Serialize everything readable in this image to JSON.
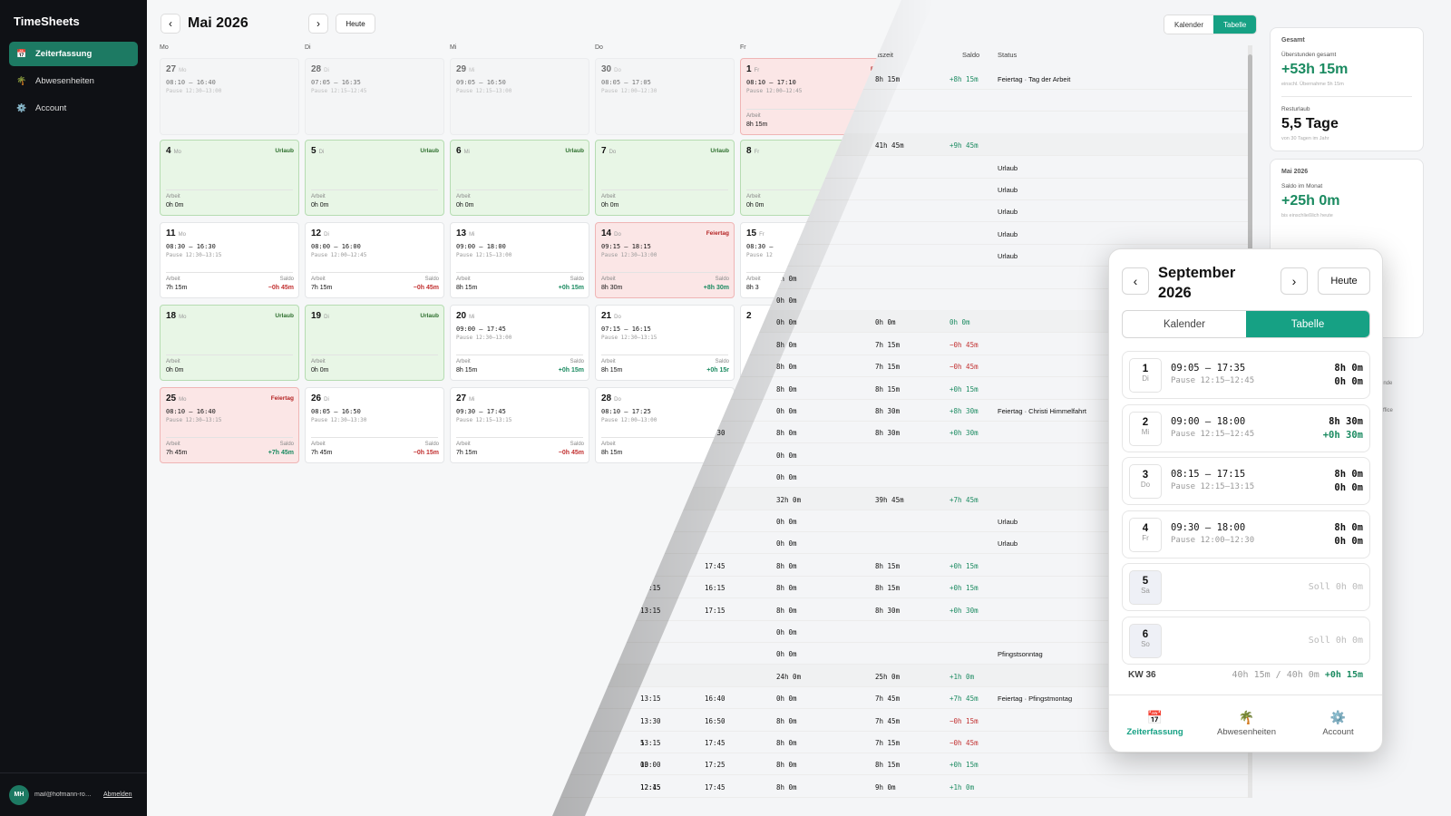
{
  "sidebar": {
    "brand": "TimeSheets",
    "items": [
      {
        "label": "Zeiterfassung",
        "icon": "📅"
      },
      {
        "label": "Abwesenheiten",
        "icon": "🌴"
      },
      {
        "label": "Account",
        "icon": "⚙️"
      }
    ],
    "avatar": "MH",
    "email": "mail@hofmann-ro…",
    "logout": "Abmelden"
  },
  "calendar": {
    "month": "Mai 2026",
    "today": "Heute",
    "prev": "‹",
    "next": "›",
    "dows": [
      "Mo",
      "Di",
      "Mi",
      "Do",
      "Fr"
    ],
    "weeks": [
      [
        {
          "d": "27",
          "w": "Mo",
          "type": "dim",
          "t": "08:10 – 16:40",
          "p": "Pause 12:30–13:00"
        },
        {
          "d": "28",
          "w": "Di",
          "type": "dim",
          "t": "07:05 – 16:35",
          "p": "Pause 12:15–12:45"
        },
        {
          "d": "29",
          "w": "Mi",
          "type": "dim",
          "t": "09:05 – 16:50",
          "p": "Pause 12:15–13:00"
        },
        {
          "d": "30",
          "w": "Do",
          "type": "dim",
          "t": "08:05 – 17:05",
          "p": "Pause 12:00–12:30"
        },
        {
          "d": "1",
          "w": "Fr",
          "type": "hol",
          "tag": "F",
          "t": "08:10 – 17:10",
          "p": "Pause 12:00–12:45",
          "al": "Arbeit",
          "av": "8h 15m"
        }
      ],
      [
        {
          "d": "4",
          "w": "Mo",
          "type": "vac",
          "tag": "Urlaub",
          "al": "Arbeit",
          "av": "0h 0m"
        },
        {
          "d": "5",
          "w": "Di",
          "type": "vac",
          "tag": "Urlaub",
          "al": "Arbeit",
          "av": "0h 0m"
        },
        {
          "d": "6",
          "w": "Mi",
          "type": "vac",
          "tag": "Urlaub",
          "al": "Arbeit",
          "av": "0h 0m"
        },
        {
          "d": "7",
          "w": "Do",
          "type": "vac",
          "tag": "Urlaub",
          "al": "Arbeit",
          "av": "0h 0m"
        },
        {
          "d": "8",
          "w": "Fr",
          "type": "vac",
          "al": "Arbeit",
          "av": "0h 0m"
        }
      ],
      [
        {
          "d": "11",
          "w": "Mo",
          "t": "08:30 – 16:30",
          "p": "Pause 12:30–13:15",
          "al": "Arbeit",
          "av": "7h 15m",
          "sl": "Saldo",
          "sv": "−0h 45m",
          "sc": "neg"
        },
        {
          "d": "12",
          "w": "Di",
          "t": "08:00 – 16:00",
          "p": "Pause 12:00–12:45",
          "al": "Arbeit",
          "av": "7h 15m",
          "sl": "Saldo",
          "sv": "−0h 45m",
          "sc": "neg"
        },
        {
          "d": "13",
          "w": "Mi",
          "t": "09:00 – 18:00",
          "p": "Pause 12:15–13:00",
          "al": "Arbeit",
          "av": "8h 15m",
          "sl": "Saldo",
          "sv": "+0h 15m",
          "sc": "pos"
        },
        {
          "d": "14",
          "w": "Do",
          "type": "hol",
          "tag": "Feiertag",
          "t": "09:15 – 18:15",
          "p": "Pause 12:30–13:00",
          "al": "Arbeit",
          "av": "8h 30m",
          "sl": "Saldo",
          "sv": "+8h 30m",
          "sc": "pos"
        },
        {
          "d": "15",
          "w": "Fr",
          "t": "08:30 –",
          "p": "Pause 12",
          "al": "Arbeit",
          "av": "8h 3"
        }
      ],
      [
        {
          "d": "18",
          "w": "Mo",
          "type": "vac",
          "tag": "Urlaub",
          "al": "Arbeit",
          "av": "0h 0m"
        },
        {
          "d": "19",
          "w": "Di",
          "type": "vac",
          "tag": "Urlaub",
          "al": "Arbeit",
          "av": "0h 0m"
        },
        {
          "d": "20",
          "w": "Mi",
          "t": "09:00 – 17:45",
          "p": "Pause 12:30–13:00",
          "al": "Arbeit",
          "av": "8h 15m",
          "sl": "Saldo",
          "sv": "+0h 15m",
          "sc": "pos"
        },
        {
          "d": "21",
          "w": "Do",
          "t": "07:15 – 16:15",
          "p": "Pause 12:30–13:15",
          "al": "Arbeit",
          "av": "8h 15m",
          "sl": "Saldo",
          "sv": "+0h 15r",
          "sc": "pos"
        },
        {
          "d": "2",
          "w": ""
        }
      ],
      [
        {
          "d": "25",
          "w": "Mo",
          "type": "hol",
          "tag": "Feiertag",
          "t": "08:10 – 16:40",
          "p": "Pause 12:30–13:15",
          "al": "Arbeit",
          "av": "7h 45m",
          "sl": "Saldo",
          "sv": "+7h 45m",
          "sc": "pos"
        },
        {
          "d": "26",
          "w": "Di",
          "t": "08:05 – 16:50",
          "p": "Pause 12:30–13:30",
          "al": "Arbeit",
          "av": "7h 45m",
          "sl": "Saldo",
          "sv": "−0h 15m",
          "sc": "neg"
        },
        {
          "d": "27",
          "w": "Mi",
          "t": "09:30 – 17:45",
          "p": "Pause 12:15–13:15",
          "al": "Arbeit",
          "av": "7h 15m",
          "sl": "Saldo",
          "sv": "−0h 45m",
          "sc": "neg"
        },
        {
          "d": "28",
          "w": "Do",
          "t": "08:10 – 17:25",
          "p": "Pause 12:00–13:00",
          "al": "Arbeit",
          "av": "8h 15m"
        }
      ]
    ]
  },
  "table": {
    "headers": {
      "arbeitszeit": "Arbeitszeit",
      "saldo": "Saldo",
      "status": "Status"
    },
    "rows": [
      {
        "c1": "8h 15m",
        "c2": "8h 15m",
        "c3": "+8h 15m",
        "st": "Feiertag · Tag der Arbeit"
      },
      {},
      {},
      {
        "wk": true,
        "c2": "41h 45m",
        "c3": "+9h 45m"
      },
      {
        "st": "Urlaub"
      },
      {
        "st": "Urlaub"
      },
      {
        "c0": "m",
        "st": "Urlaub"
      },
      {
        "st": "Urlaub"
      },
      {
        "st": "Urlaub"
      },
      {
        "c1": "0h 0m"
      },
      {
        "c1": "0h 0m"
      },
      {
        "wk": true,
        "c0": "2",
        "c1": "0h 0m",
        "c2": "0h 0m",
        "c3": "0h 0m"
      },
      {
        "c1": "8h 0m",
        "c2": "7h 15m",
        "c3": "−0h 45m",
        "cc": "neg"
      },
      {
        "c1": "8h 0m",
        "c2": "7h 15m",
        "c3": "−0h 45m",
        "cc": "neg"
      },
      {
        "c0": "0",
        "c1": "8h 0m",
        "c2": "8h 15m",
        "c3": "+0h 15m",
        "cc": "pos"
      },
      {
        "c0": "15",
        "c1": "0h 0m",
        "c2": "8h 30m",
        "c3": "+8h 30m",
        "cc": "pos",
        "st": "Feiertag · Christi Himmelfahrt"
      },
      {
        "e1": "17:30",
        "c1": "8h 0m",
        "c2": "8h 30m",
        "c3": "+0h 30m",
        "cc": "pos"
      },
      {
        "c1": "0h 0m"
      },
      {
        "c1": "0h 0m"
      },
      {
        "wk": true,
        "c1": "32h 0m",
        "c2": "39h 45m",
        "c3": "+7h 45m",
        "cc": "pos"
      },
      {
        "c1": "0h 0m",
        "st": "Urlaub"
      },
      {
        "c1": "0h 0m",
        "st": "Urlaub"
      },
      {
        "s1": "3:00",
        "e1": "17:45",
        "c1": "8h 0m",
        "c2": "8h 15m",
        "c3": "+0h 15m",
        "cc": "pos"
      },
      {
        "s1": "13:15",
        "e1": "16:15",
        "c1": "8h 0m",
        "c2": "8h 15m",
        "c3": "+0h 15m",
        "cc": "pos"
      },
      {
        "s1": "13:15",
        "e1": "17:15",
        "c1": "8h 0m",
        "c2": "8h 30m",
        "c3": "+0h 30m",
        "cc": "pos"
      },
      {
        "c1": "0h 0m"
      },
      {
        "c1": "0h 0m",
        "st": "Pfingstsonntag"
      },
      {
        "wk": true,
        "c1": "24h 0m",
        "c2": "25h 0m",
        "c3": "+1h 0m",
        "cc": "pos"
      },
      {
        "s1": "13:15",
        "e1": "16:40",
        "c1": "0h 0m",
        "c2": "7h 45m",
        "c3": "+7h 45m",
        "cc": "pos",
        "st": "Feiertag · Pfingstmontag"
      },
      {
        "s1": "13:30",
        "e1": "16:50",
        "c1": "8h 0m",
        "c2": "7h 45m",
        "c3": "−0h 15m",
        "cc": "neg"
      },
      {
        "c0": "5",
        "s1": "13:15",
        "e1": "17:45",
        "c1": "8h 0m",
        "c2": "7h 15m",
        "c3": "−0h 45m",
        "cc": "neg"
      },
      {
        "c0": "00",
        "s1": "13:00",
        "e1": "17:25",
        "c1": "8h 0m",
        "c2": "8h 15m",
        "c3": "+0h 15m",
        "cc": "pos"
      },
      {
        "c0": "12:15",
        "s1": "12:45",
        "e1": "17:45",
        "c1": "8h 0m",
        "c2": "9h 0m",
        "c3": "+1h 0m",
        "cc": "pos"
      }
    ]
  },
  "viewToggle": {
    "kalender": "Kalender",
    "tabelle": "Tabelle"
  },
  "stats": {
    "gesamt": {
      "header": "Gesamt",
      "l1": "Überstunden gesamt",
      "v1": "+53h 15m",
      "s1": "einschl. Übernahme 5h 15m",
      "l2": "Resturlaub",
      "v2": "5,5 Tage",
      "s2": "von 30 Tagen im Jahr"
    },
    "monat": {
      "header": "Mai 2026",
      "l1": "Saldo im Monat",
      "v1": "+25h 0m",
      "s1": "bis einschließlich heute"
    },
    "behind1": "ende",
    "behind2": "ffice"
  },
  "mobile": {
    "title": "September 2026",
    "prev": "‹",
    "next": "›",
    "today": "Heute",
    "seg": [
      "Kalender",
      "Tabelle"
    ],
    "rows": [
      {
        "d": "1",
        "w": "Di",
        "t": "09:05 – 17:35",
        "p": "Pause 12:15–12:45",
        "h": "8h 0m",
        "s": "0h 0m"
      },
      {
        "d": "2",
        "w": "Mi",
        "t": "09:00 – 18:00",
        "p": "Pause 12:15–12:45",
        "h": "8h 30m",
        "s": "+0h 30m",
        "pos": true
      },
      {
        "d": "3",
        "w": "Do",
        "t": "08:15 – 17:15",
        "p": "Pause 12:15–13:15",
        "h": "8h 0m",
        "s": "0h 0m"
      },
      {
        "d": "4",
        "w": "Fr",
        "t": "09:30 – 18:00",
        "p": "Pause 12:00–12:30",
        "h": "8h 0m",
        "s": "0h 0m"
      },
      {
        "d": "5",
        "w": "Sa",
        "soll": "Soll 0h 0m"
      },
      {
        "d": "6",
        "w": "So",
        "soll": "Soll 0h 0m"
      }
    ],
    "kw": "KW 36",
    "kwv": "40h 15m / 40h 0m",
    "kws": "+0h 15m",
    "tabs": [
      {
        "label": "Zeiterfassung",
        "icon": "📅"
      },
      {
        "label": "Abwesenheiten",
        "icon": "🌴"
      },
      {
        "label": "Account",
        "icon": "⚙️"
      }
    ]
  }
}
